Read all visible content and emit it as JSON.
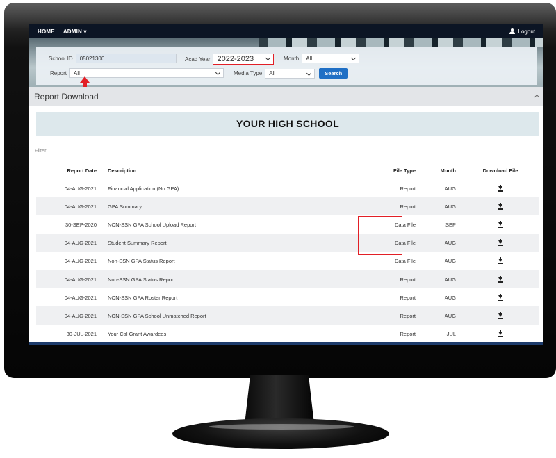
{
  "nav": {
    "home": "HOME",
    "admin": "ADMIN ▾",
    "logout": "Logout"
  },
  "search": {
    "school_id_label": "School ID",
    "school_id_value": "05021300",
    "acad_year_label": "Acad Year",
    "acad_year_value": "2022-2023",
    "month_label": "Month",
    "month_value": "All",
    "report_label": "Report",
    "report_value": "All",
    "media_type_label": "Media Type",
    "media_type_value": "All",
    "search_button": "Search"
  },
  "panel": {
    "title": "Report Download"
  },
  "school_banner": "YOUR HIGH SCHOOL",
  "filter": {
    "placeholder": "Filter"
  },
  "table": {
    "headers": {
      "date": "Report Date",
      "desc": "Description",
      "type": "File Type",
      "month": "Month",
      "download": "Download File"
    },
    "rows": [
      {
        "date": "04-AUG-2021",
        "desc": "Financial Application (No GPA)",
        "type": "Report",
        "month": "AUG"
      },
      {
        "date": "04-AUG-2021",
        "desc": "GPA Summary",
        "type": "Report",
        "month": "AUG"
      },
      {
        "date": "30-SEP-2020",
        "desc": "NON-SSN GPA School Upload Report",
        "type": "Data File",
        "month": "SEP"
      },
      {
        "date": "04-AUG-2021",
        "desc": "Student Summary Report",
        "type": "Data File",
        "month": "AUG"
      },
      {
        "date": "04-AUG-2021",
        "desc": "Non-SSN GPA Status Report",
        "type": "Data File",
        "month": "AUG"
      },
      {
        "date": "04-AUG-2021",
        "desc": "Non-SSN GPA Status Report",
        "type": "Report",
        "month": "AUG"
      },
      {
        "date": "04-AUG-2021",
        "desc": "NON-SSN GPA Roster Report",
        "type": "Report",
        "month": "AUG"
      },
      {
        "date": "04-AUG-2021",
        "desc": "NON-SSN GPA School Unmatched Report",
        "type": "Report",
        "month": "AUG"
      },
      {
        "date": "30-JUL-2021",
        "desc": "Your Cal Grant Awardees",
        "type": "Report",
        "month": "JUL"
      }
    ]
  },
  "colors": {
    "navbar": "#0c1524",
    "search_button": "#1f6fc5",
    "annotation_red": "#e21f26",
    "banner": "#dde8ec"
  }
}
